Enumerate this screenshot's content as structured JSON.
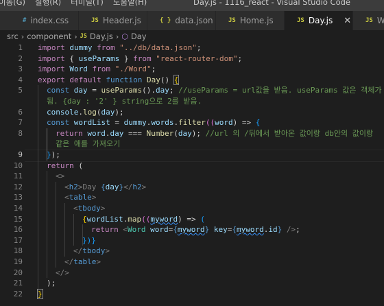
{
  "menu": [
    "이동(G)",
    "실행(R)",
    "터미널(T)",
    "도움말(H)"
  ],
  "window_title": "Day.js - 1116_react - Visual Studio Code",
  "tabs": [
    {
      "icon": "#",
      "icon_color": "#519aba",
      "label": "index.css"
    },
    {
      "icon": "JS",
      "icon_color": "#cbcb41",
      "label": "Header.js"
    },
    {
      "icon": "{ }",
      "icon_color": "#cbcb41",
      "label": "data.json"
    },
    {
      "icon": "JS",
      "icon_color": "#cbcb41",
      "label": "Home.js"
    },
    {
      "icon": "JS",
      "icon_color": "#cbcb41",
      "label": "Day.js",
      "active": true,
      "close": "✕"
    },
    {
      "icon": "JS",
      "icon_color": "#cbcb41",
      "label": "Wo"
    }
  ],
  "breadcrumb": {
    "parts": [
      "src",
      "component",
      "Day.js",
      "Day"
    ],
    "icon_js": "JS",
    "icon_symbol": "⬡"
  },
  "line_numbers": [
    "1",
    "2",
    "3",
    "4",
    "5",
    "6",
    "",
    "7",
    "8",
    "9",
    "",
    "10",
    "11",
    "12",
    "13",
    "14",
    "15",
    "16",
    "17",
    "18",
    "19",
    "20",
    "21",
    "22"
  ],
  "code": {
    "l1": [
      "import",
      " ",
      "dummy",
      " ",
      "from",
      " ",
      "\"../db/data.json\"",
      ";"
    ],
    "l2": [
      "import",
      " { ",
      "useParams",
      " } ",
      "from",
      " ",
      "\"react-router-dom\"",
      ";"
    ],
    "l3": [
      "import",
      " ",
      "Word",
      " ",
      "from",
      " ",
      "\"./Word\"",
      ";"
    ],
    "l4": [
      "export",
      " ",
      "default",
      " ",
      "function",
      " ",
      "Day",
      "() ",
      "{"
    ],
    "l5": [
      "const",
      " ",
      "day",
      " = ",
      "useParams",
      "().",
      "day",
      "; ",
      "//useParams = url값을 받음. useParams 값은 객체가"
    ],
    "l5b": [
      "됨. {day : '2' } string으로 2를 받음."
    ],
    "l6": [
      "console",
      ".",
      "log",
      "(",
      "day",
      ");"
    ],
    "l7": [
      "const",
      " ",
      "wordList",
      " = ",
      "dummy",
      ".",
      "words",
      ".",
      "filter",
      "((",
      "word",
      ") => ",
      "{"
    ],
    "l8": [
      "return",
      " ",
      "word",
      ".",
      "day",
      " === ",
      "Number",
      "(",
      "day",
      "); ",
      "//url 의 /뒤에서 받아온 값이랑 db안의 값이랑"
    ],
    "l8b": [
      "같은 애를 가져오기"
    ],
    "l9": [
      "}",
      ");"
    ],
    "l10": [
      "return",
      " ("
    ],
    "l11": [
      "<>"
    ],
    "l12": [
      "<",
      "h2",
      ">Day ",
      "{",
      "day",
      "}",
      "</",
      "h2",
      ">"
    ],
    "l13": [
      "<",
      "table",
      ">"
    ],
    "l14": [
      "<",
      "tbody",
      ">"
    ],
    "l15": [
      "{",
      "wordList",
      ".",
      "map",
      "((",
      "myword",
      ") => ",
      "("
    ],
    "l16": [
      "return",
      " <",
      "Word",
      " ",
      "word",
      "=",
      "{",
      "myword",
      "}",
      " ",
      "key",
      "=",
      "{",
      "myword",
      ".",
      "id",
      "}",
      " />",
      ";"
    ],
    "l17": [
      "})}"
    ],
    "l18": [
      "</",
      "tbody",
      ">"
    ],
    "l19": [
      "</",
      "table",
      ">"
    ],
    "l20": [
      "</>"
    ],
    "l21": [
      ");"
    ],
    "l22": [
      "}"
    ]
  }
}
